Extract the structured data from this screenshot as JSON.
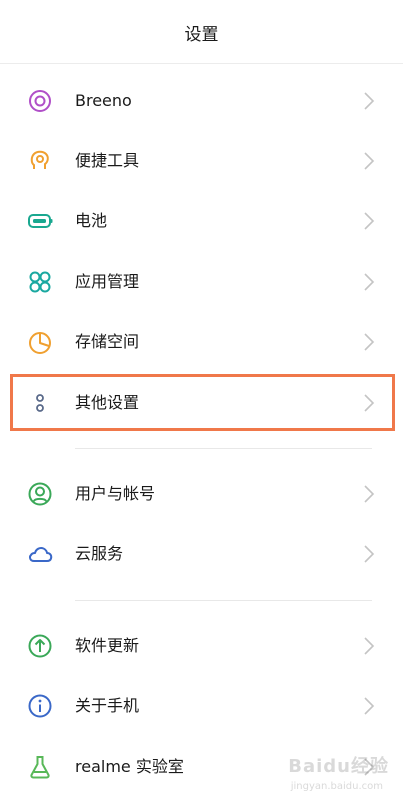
{
  "header": {
    "title": "设置"
  },
  "items": [
    {
      "label": "Breeno",
      "icon": "breeno-icon",
      "color": "#b04fc8"
    },
    {
      "label": "便捷工具",
      "icon": "convenience-tools-icon",
      "color": "#f0a030"
    },
    {
      "label": "电池",
      "icon": "battery-icon",
      "color": "#1aa890"
    },
    {
      "label": "应用管理",
      "icon": "app-management-icon",
      "color": "#1aa8a0"
    },
    {
      "label": "存储空间",
      "icon": "storage-icon",
      "color": "#f0a030"
    },
    {
      "label": "其他设置",
      "icon": "other-settings-icon",
      "color": "#5a6a8a"
    },
    {
      "label": "用户与帐号",
      "icon": "user-account-icon",
      "color": "#3aa858"
    },
    {
      "label": "云服务",
      "icon": "cloud-service-icon",
      "color": "#3a68c8"
    },
    {
      "label": "软件更新",
      "icon": "software-update-icon",
      "color": "#3aa858"
    },
    {
      "label": "关于手机",
      "icon": "about-phone-icon",
      "color": "#3a68c8"
    },
    {
      "label": "realme 实验室",
      "icon": "realme-lab-icon",
      "color": "#58b858"
    }
  ],
  "highlight_color": "#f0784a",
  "watermark": {
    "text": "Baidu经验",
    "sub": "jingyan.baidu.com"
  }
}
